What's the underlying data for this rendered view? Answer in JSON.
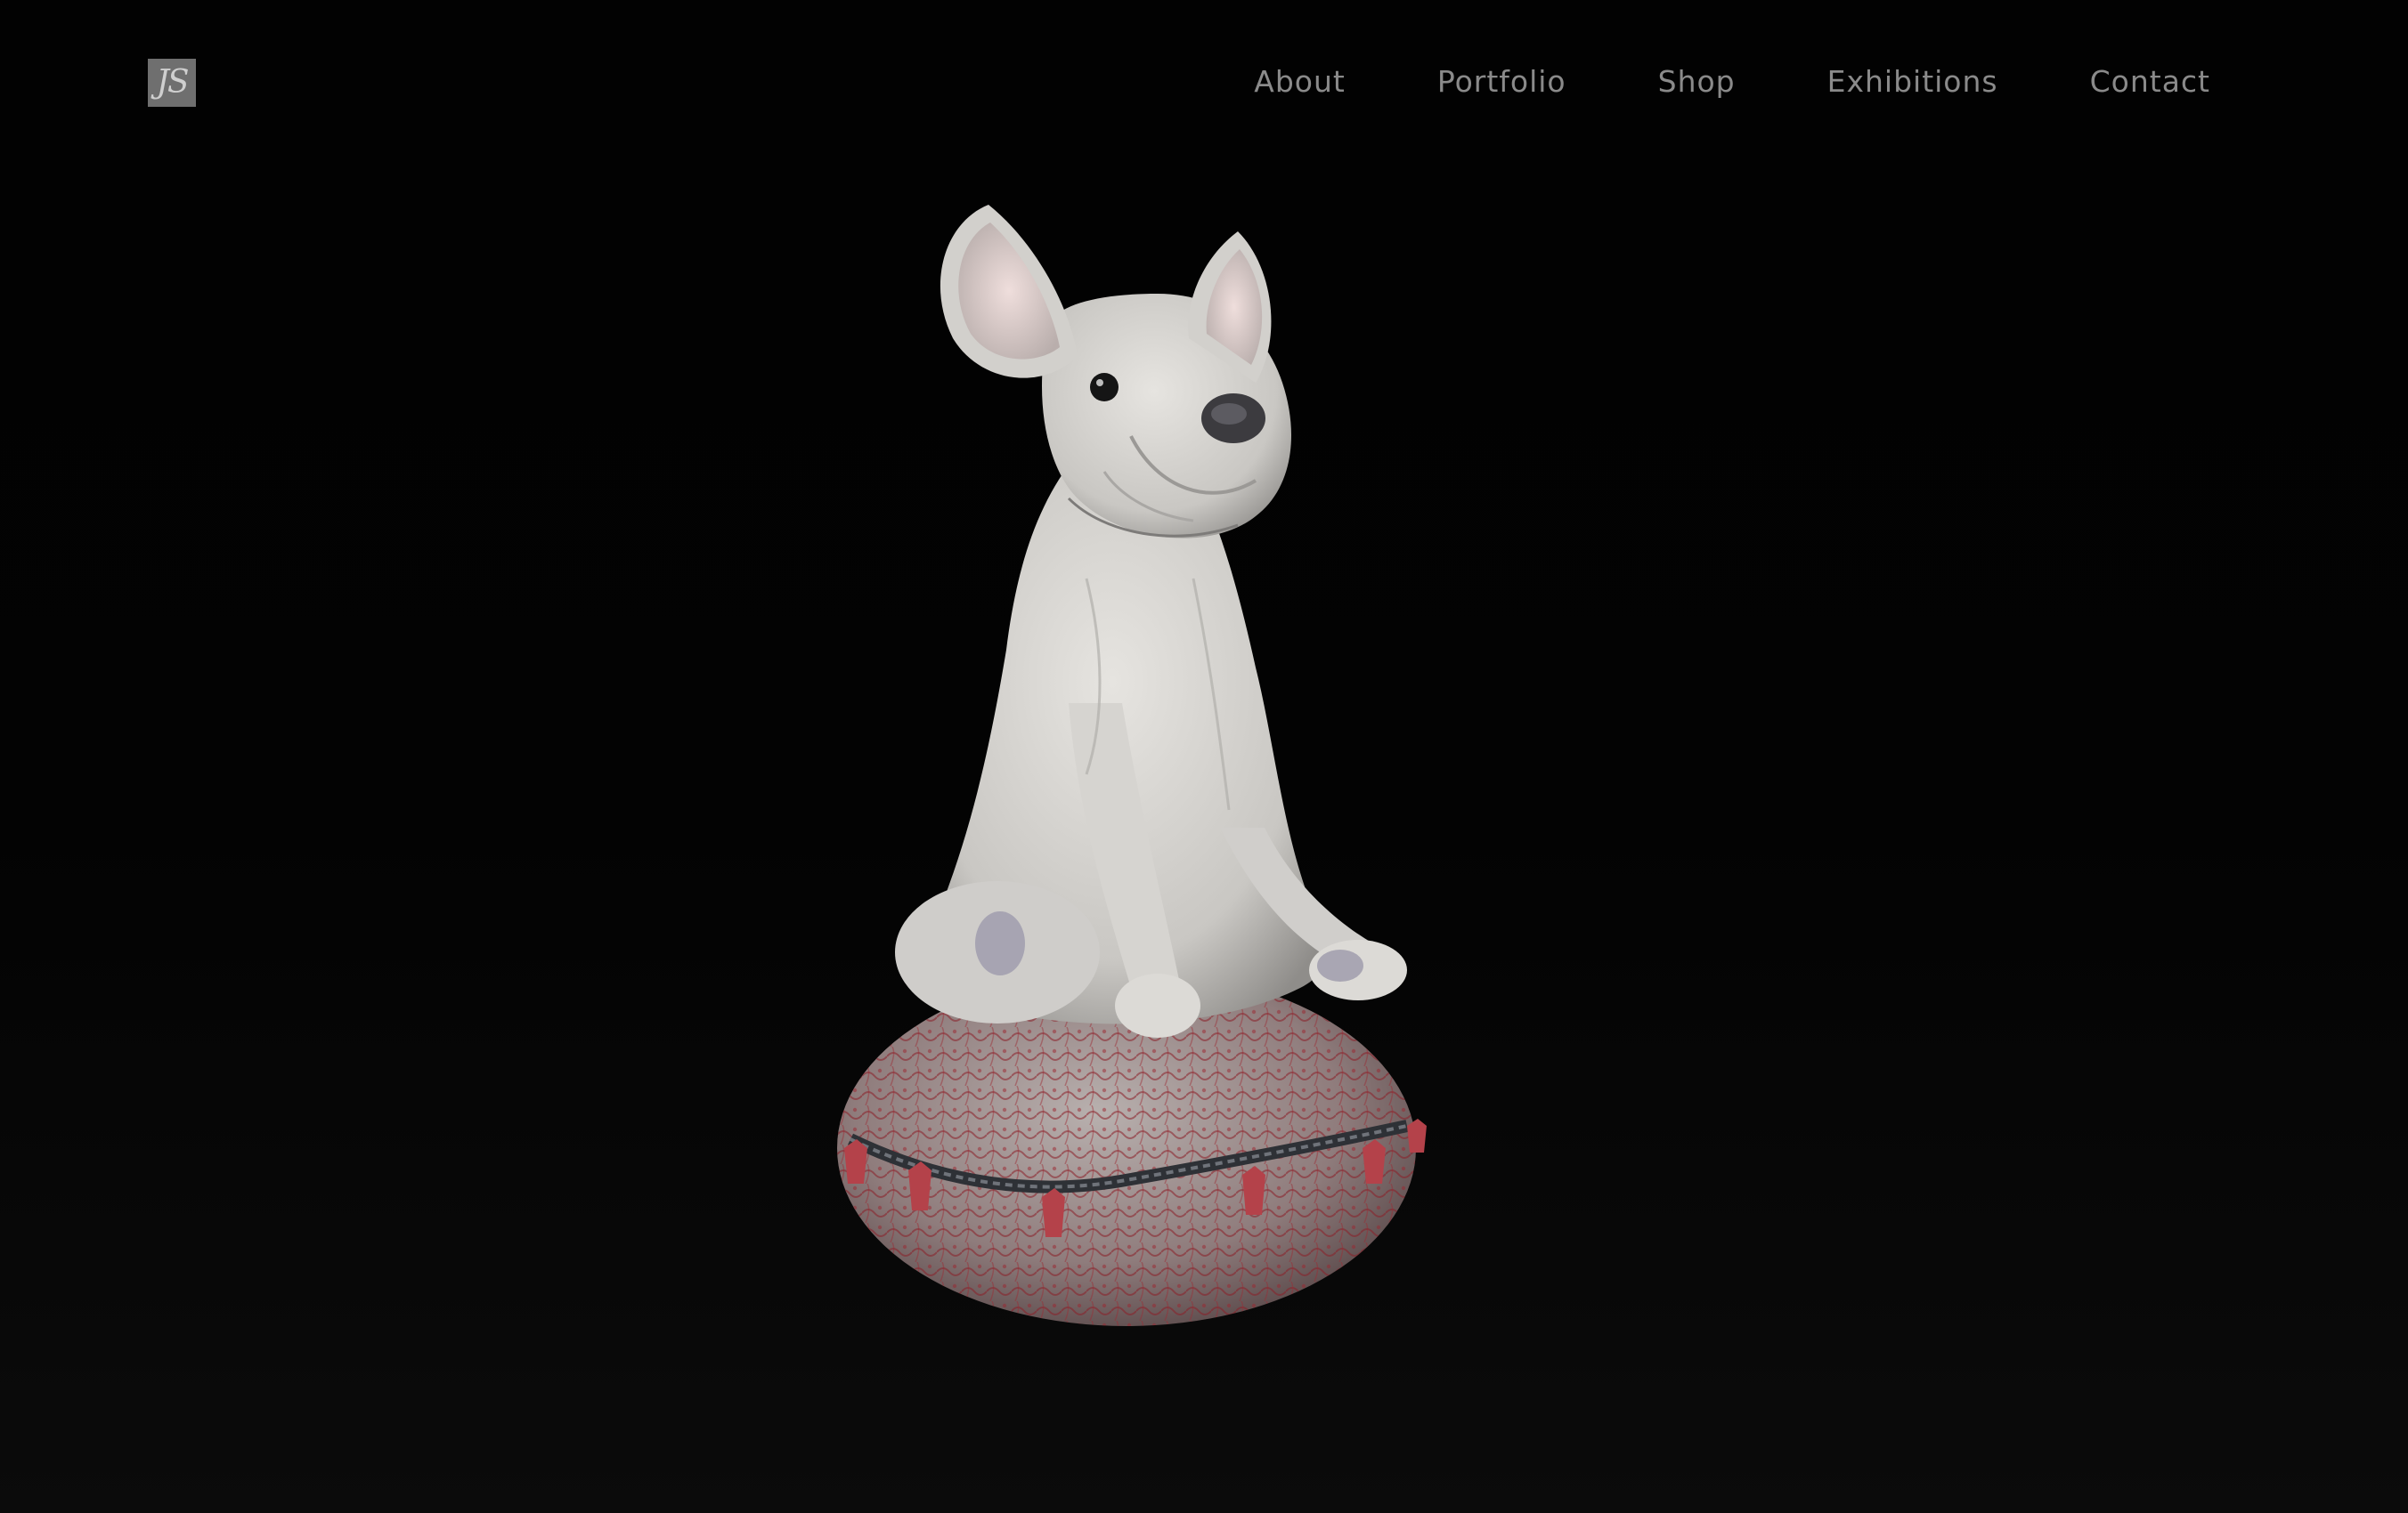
{
  "logo": {
    "text": "JS"
  },
  "nav": {
    "items": [
      {
        "label": "About"
      },
      {
        "label": "Portfolio"
      },
      {
        "label": "Shop"
      },
      {
        "label": "Exhibitions"
      },
      {
        "label": "Contact"
      }
    ]
  },
  "hero": {
    "image": "white-ceramic-french-bulldog-on-red-cushion"
  },
  "colors": {
    "background": "#000000",
    "nav_text": "#8a8a8a",
    "logo_bg": "#6f6f6f"
  }
}
